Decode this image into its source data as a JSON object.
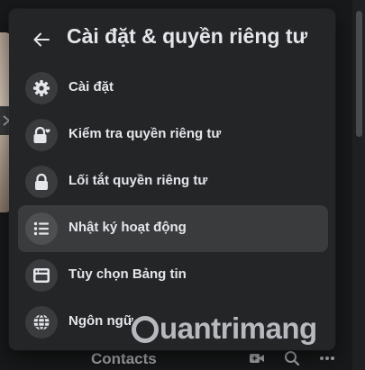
{
  "menu": {
    "title": "Cài đặt & quyền riêng tư",
    "items": [
      {
        "label": "Cài đặt",
        "icon": "gear-icon"
      },
      {
        "label": "Kiểm tra quyền riêng tư",
        "icon": "lock-heart-icon"
      },
      {
        "label": "Lối tắt quyền riêng tư",
        "icon": "lock-icon"
      },
      {
        "label": "Nhật ký hoạt động",
        "icon": "list-icon",
        "active": true
      },
      {
        "label": "Tùy chọn Bảng tin",
        "icon": "feed-icon"
      },
      {
        "label": "Ngôn ngữ",
        "icon": "globe-icon"
      }
    ]
  },
  "bottom": {
    "contacts_label": "Contacts"
  },
  "watermark": {
    "text": "uantrimang"
  },
  "colors": {
    "background": "#18191a",
    "panel": "#242526",
    "icon_circle": "#3a3b3c",
    "text": "#e4e6eb"
  }
}
